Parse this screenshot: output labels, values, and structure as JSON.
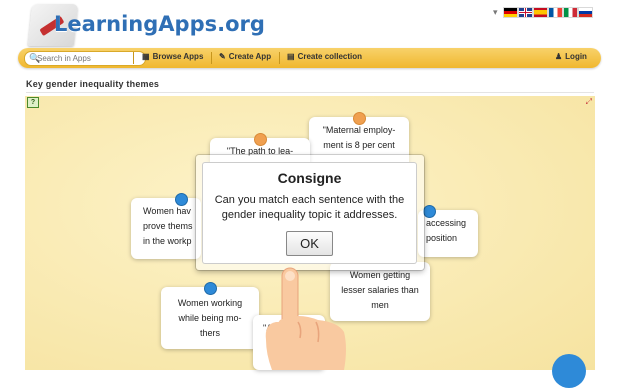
{
  "header": {
    "logo_text": "LearningApps.org",
    "languages": [
      "de",
      "en",
      "es",
      "fr",
      "it",
      "ru"
    ]
  },
  "navbar": {
    "search_placeholder": "Search in Apps",
    "browse_apps": "Browse Apps",
    "create_app": "Create App",
    "create_collection": "Create collection",
    "login": "Login"
  },
  "page": {
    "title": "Key gender inequality themes"
  },
  "cards": {
    "c1": "\"Maternal employ-ment is 8 per cent",
    "c2": "\"The path to lea-",
    "c3": "Women hav prove thems in the workp",
    "c4": "accessing position",
    "c5": "Women getting lesser salaries than men",
    "c6": "Women working while being mo-thers",
    "c7": "\"A F"
  },
  "dialog": {
    "title": "Consigne",
    "message": "Can you match each sentence with the gender inequality topic it addresses.",
    "ok_label": "OK"
  },
  "colors": {
    "navbar": "#f0b72e",
    "logo_blue": "#2f6fb5",
    "pin_blue": "#2e8ad8",
    "pin_orange": "#f0a050",
    "board_bg": "#f6e3a0"
  }
}
